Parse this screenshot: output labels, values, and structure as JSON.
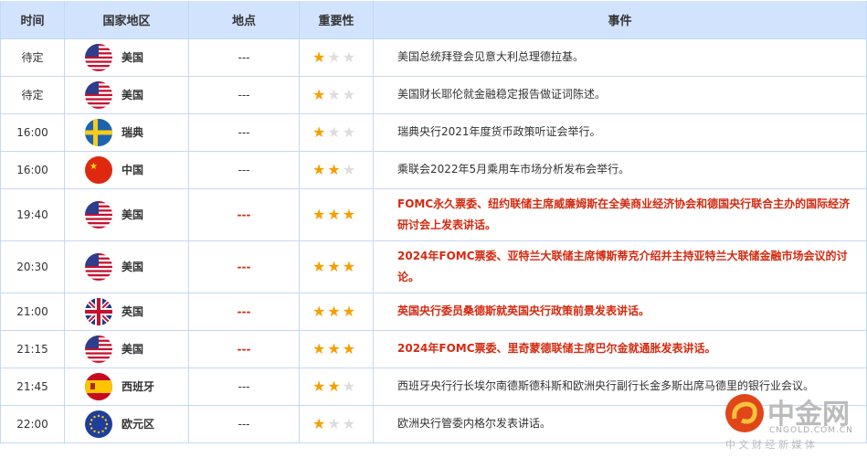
{
  "headers": {
    "time": "时间",
    "country": "国家地区",
    "location": "地点",
    "importance": "重要性",
    "event": "事件"
  },
  "colors": {
    "header_bg": "#d2e3fd",
    "highlight": "#d42a10",
    "star_on": "#f5a000",
    "star_off": "#dddddd"
  },
  "rows": [
    {
      "time": "待定",
      "country": "美国",
      "flag": "us",
      "location": "---",
      "stars": 1,
      "event": "美国总统拜登会见意大利总理德拉基。",
      "highlight": false
    },
    {
      "time": "待定",
      "country": "美国",
      "flag": "us",
      "location": "---",
      "stars": 1,
      "event": "美国财长耶伦就金融稳定报告做证词陈述。",
      "highlight": false
    },
    {
      "time": "16:00",
      "country": "瑞典",
      "flag": "se",
      "location": "---",
      "stars": 1,
      "event": "瑞典央行2021年度货币政策听证会举行。",
      "highlight": false
    },
    {
      "time": "16:00",
      "country": "中国",
      "flag": "cn",
      "location": "---",
      "stars": 2,
      "event": "乘联会2022年5月乘用车市场分析发布会举行。",
      "highlight": false
    },
    {
      "time": "19:40",
      "country": "美国",
      "flag": "us",
      "location": "---",
      "stars": 3,
      "event": "FOMC永久票委、纽约联储主席威廉姆斯在全美商业经济协会和德国央行联合主办的国际经济研讨会上发表讲话。",
      "highlight": true
    },
    {
      "time": "20:30",
      "country": "美国",
      "flag": "us",
      "location": "---",
      "stars": 3,
      "event": "2024年FOMC票委、亚特兰大联储主席博斯蒂克介绍并主持亚特兰大联储金融市场会议的讨论。",
      "highlight": true
    },
    {
      "time": "21:00",
      "country": "英国",
      "flag": "gb",
      "location": "---",
      "stars": 3,
      "event": "英国央行委员桑德斯就英国央行政策前景发表讲话。",
      "highlight": true
    },
    {
      "time": "21:15",
      "country": "美国",
      "flag": "us",
      "location": "---",
      "stars": 3,
      "event": "2024年FOMC票委、里奇蒙德联储主席巴尔金就通胀发表讲话。",
      "highlight": true
    },
    {
      "time": "21:45",
      "country": "西班牙",
      "flag": "es",
      "location": "---",
      "stars": 2,
      "event": "西班牙央行行长埃尔南德斯德科斯和欧洲央行副行长金多斯出席马德里的银行业会议。",
      "highlight": false
    },
    {
      "time": "22:00",
      "country": "欧元区",
      "flag": "eu",
      "location": "---",
      "stars": 1,
      "event": "欧洲央行管委内格尔发表讲话。",
      "highlight": false
    }
  ],
  "watermark": {
    "name": "中金网",
    "domain": "CNGOLD.COM.CN",
    "slogan": "中 文 财 经 新 媒 体"
  }
}
